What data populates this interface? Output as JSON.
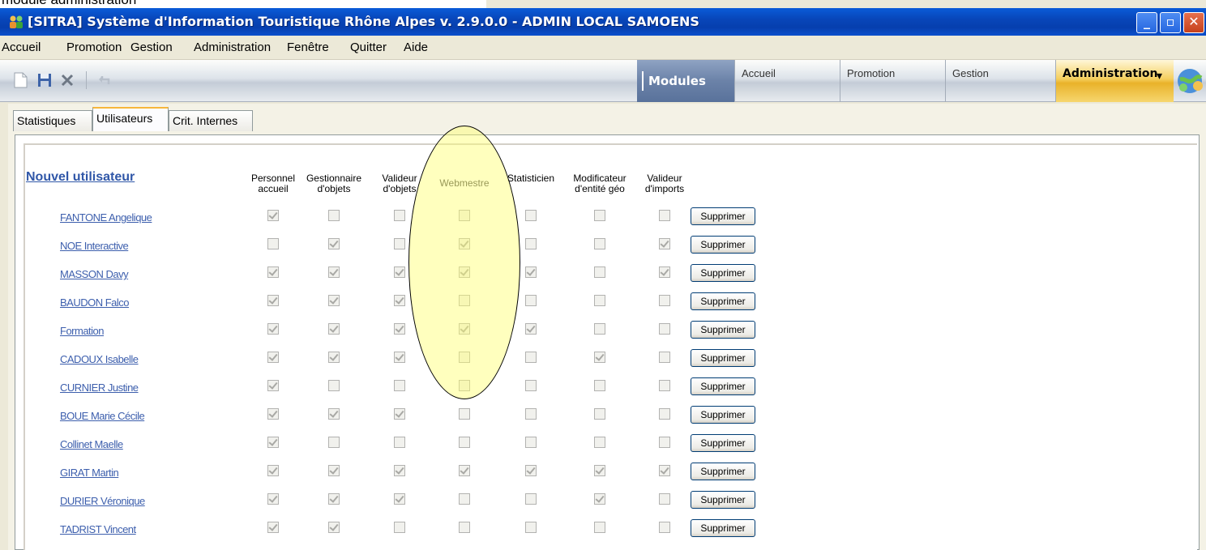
{
  "caption": "module administration",
  "window": {
    "title": "[SITRA] Système d'Information Touristique Rhône Alpes v. 2.9.0.0 -  ADMIN LOCAL SAMOENS",
    "minimize": "_",
    "maximize": "▫",
    "close": "✕"
  },
  "menu": [
    "Accueil",
    "Promotion",
    "Gestion",
    "Administration",
    "Fenêtre",
    "Quitter",
    "Aide"
  ],
  "modules": {
    "label": "Modules",
    "tabs": [
      "Accueil",
      "Promotion",
      "Gestion",
      "Administration"
    ],
    "active": "Administration"
  },
  "tabs": [
    "Statistiques",
    "Utilisateurs",
    "Crit. Internes"
  ],
  "active_tab": "Utilisateurs",
  "new_user_label": "Nouvel utilisateur",
  "columns": [
    "Personnel accueil",
    "Gestionnaire d'objets",
    "Valideur d'objets",
    "Webmestre",
    "Statisticien",
    "Modificateur d'entité géo",
    "Valideur d'imports"
  ],
  "delete_label": "Supprimer",
  "users": [
    {
      "name": "FANTONE Angelique",
      "perms": [
        true,
        false,
        false,
        false,
        false,
        false,
        false
      ]
    },
    {
      "name": "NOE Interactive",
      "perms": [
        false,
        true,
        false,
        true,
        false,
        false,
        true
      ]
    },
    {
      "name": "MASSON Davy",
      "perms": [
        true,
        true,
        true,
        true,
        true,
        false,
        true
      ]
    },
    {
      "name": "BAUDON Falco",
      "perms": [
        true,
        true,
        true,
        false,
        false,
        false,
        false
      ]
    },
    {
      "name": "Formation",
      "perms": [
        true,
        true,
        true,
        true,
        true,
        false,
        false
      ]
    },
    {
      "name": "CADOUX Isabelle",
      "perms": [
        true,
        true,
        true,
        false,
        false,
        true,
        false
      ]
    },
    {
      "name": "CURNIER Justine",
      "perms": [
        true,
        false,
        false,
        false,
        false,
        false,
        false
      ]
    },
    {
      "name": "BOUE Marie Cécile",
      "perms": [
        true,
        true,
        true,
        false,
        false,
        false,
        false
      ]
    },
    {
      "name": "Collinet Maelle",
      "perms": [
        true,
        false,
        false,
        false,
        false,
        false,
        false
      ]
    },
    {
      "name": "GIRAT Martin",
      "perms": [
        true,
        true,
        true,
        true,
        true,
        true,
        true
      ]
    },
    {
      "name": "DURIER Véronique",
      "perms": [
        true,
        true,
        true,
        false,
        false,
        true,
        false
      ]
    },
    {
      "name": "TADRIST Vincent",
      "perms": [
        true,
        true,
        false,
        false,
        false,
        false,
        false
      ]
    }
  ],
  "colors": {
    "titlebar": "#0846b9",
    "highlight": "#ffff6e",
    "link": "#3d5fad",
    "active_module": "#f5cf5e"
  }
}
